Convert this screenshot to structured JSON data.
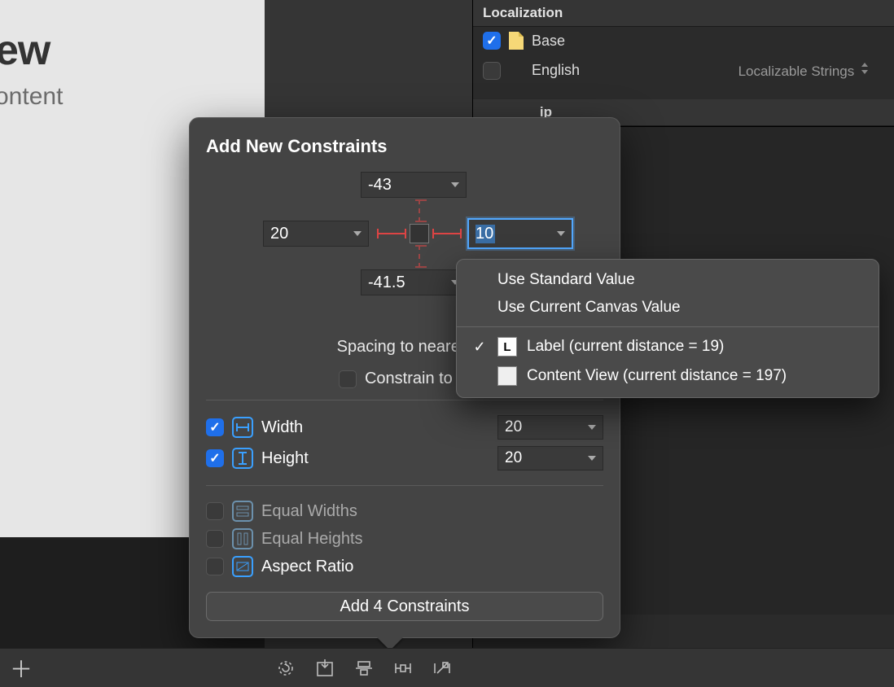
{
  "canvas": {
    "title_fragment": "ew",
    "subtitle_fragment": "ontent"
  },
  "inspector": {
    "localization_header": "Localization",
    "base_label": "Base",
    "english_label": "English",
    "english_mode": "Localizable Strings",
    "target_header_fragment": "ip"
  },
  "popover": {
    "title": "Add New Constraints",
    "top_value": "-43",
    "left_value": "20",
    "right_value": "10",
    "bottom_value": "-41.5",
    "spacing_label": "Spacing to nearest",
    "constrain_margins_label": "Constrain to m",
    "width_label": "Width",
    "width_value": "20",
    "height_label": "Height",
    "height_value": "20",
    "equal_widths_label": "Equal Widths",
    "equal_heights_label": "Equal Heights",
    "aspect_ratio_label": "Aspect Ratio",
    "add_button_label": "Add 4 Constraints"
  },
  "ctx": {
    "use_standard": "Use Standard Value",
    "use_current": "Use Current Canvas Value",
    "opt_label": "Label (current distance = 19)",
    "opt_content_view": "Content View (current distance = 197)"
  }
}
